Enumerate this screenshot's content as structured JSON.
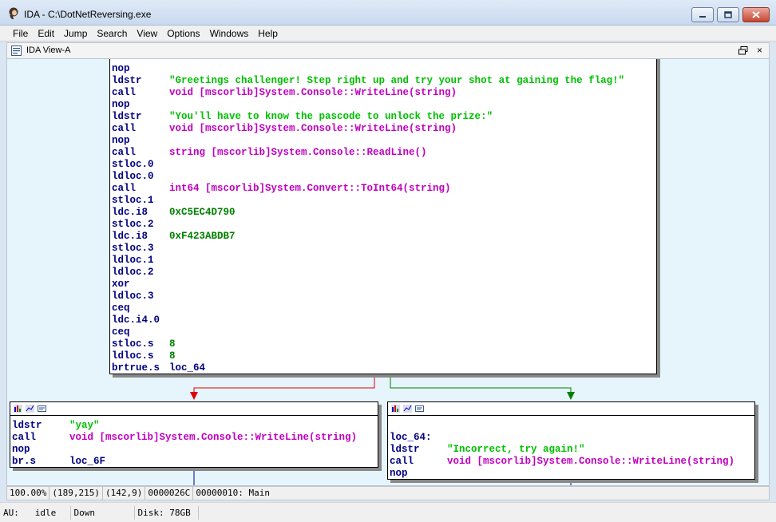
{
  "window": {
    "title": "IDA - C:\\DotNetReversing.exe"
  },
  "menu": [
    "File",
    "Edit",
    "Jump",
    "Search",
    "View",
    "Options",
    "Windows",
    "Help"
  ],
  "view": {
    "title": "IDA View-A",
    "close_glyph": "×"
  },
  "nodes": {
    "main": [
      {
        "op": "nop",
        "arg": "",
        "kind": ""
      },
      {
        "op": "ldstr",
        "arg": "\"Greetings challenger! Step right up and try your shot at gaining the flag!\"",
        "kind": "str"
      },
      {
        "op": "call",
        "arg": "void [mscorlib]System.Console::WriteLine(string)",
        "kind": "callref"
      },
      {
        "op": "nop",
        "arg": "",
        "kind": ""
      },
      {
        "op": "ldstr",
        "arg": "\"You'll have to know the pascode to unlock the prize:\"",
        "kind": "str"
      },
      {
        "op": "call",
        "arg": "void [mscorlib]System.Console::WriteLine(string)",
        "kind": "callref"
      },
      {
        "op": "nop",
        "arg": "",
        "kind": ""
      },
      {
        "op": "call",
        "arg": "string [mscorlib]System.Console::ReadLine()",
        "kind": "callref"
      },
      {
        "op": "stloc.0",
        "arg": "",
        "kind": ""
      },
      {
        "op": "ldloc.0",
        "arg": "",
        "kind": ""
      },
      {
        "op": "call",
        "arg": "int64 [mscorlib]System.Convert::ToInt64(string)",
        "kind": "callref"
      },
      {
        "op": "stloc.1",
        "arg": "",
        "kind": ""
      },
      {
        "op": "ldc.i8",
        "arg": "0xC5EC4D790",
        "kind": "num"
      },
      {
        "op": "stloc.2",
        "arg": "",
        "kind": ""
      },
      {
        "op": "ldc.i8",
        "arg": "0xF423ABDB7",
        "kind": "num"
      },
      {
        "op": "stloc.3",
        "arg": "",
        "kind": ""
      },
      {
        "op": "ldloc.1",
        "arg": "",
        "kind": ""
      },
      {
        "op": "ldloc.2",
        "arg": "",
        "kind": ""
      },
      {
        "op": "xor",
        "arg": "",
        "kind": ""
      },
      {
        "op": "ldloc.3",
        "arg": "",
        "kind": ""
      },
      {
        "op": "ceq",
        "arg": "",
        "kind": ""
      },
      {
        "op": "ldc.i4.0",
        "arg": "",
        "kind": ""
      },
      {
        "op": "ceq",
        "arg": "",
        "kind": ""
      },
      {
        "op": "stloc.s",
        "arg": "8",
        "kind": "num"
      },
      {
        "op": "ldloc.s",
        "arg": "8",
        "kind": "num"
      },
      {
        "op": "brtrue.s",
        "arg": "loc_64",
        "kind": "label"
      }
    ],
    "yay": [
      {
        "op": "ldstr",
        "arg": "\"yay\"",
        "kind": "str"
      },
      {
        "op": "call",
        "arg": "void [mscorlib]System.Console::WriteLine(string)",
        "kind": "callref"
      },
      {
        "op": "nop",
        "arg": "",
        "kind": ""
      },
      {
        "op": "br.s",
        "arg": "loc_6F",
        "kind": "label"
      }
    ],
    "loc64": [
      {
        "op": "",
        "arg": "",
        "kind": ""
      },
      {
        "op": "loc_64:",
        "arg": "",
        "kind": ""
      },
      {
        "op": "ldstr",
        "arg": "\"Incorrect, try again!\"",
        "kind": "str"
      },
      {
        "op": "call",
        "arg": "void [mscorlib]System.Console::WriteLine(string)",
        "kind": "callref"
      },
      {
        "op": "nop",
        "arg": "",
        "kind": ""
      }
    ]
  },
  "coord_bar": [
    "100.00%",
    "(189,215)",
    "(142,9)",
    "0000026C",
    "00000010: Main"
  ],
  "status_bar": {
    "au_label": "AU:",
    "au_state": "idle",
    "direction": "Down",
    "disk": "Disk: 78GB"
  },
  "colors": {
    "edge_false": "#e00000",
    "edge_true": "#008000",
    "edge_plain": "#0000a0",
    "mnemonic": "#000080",
    "string": "#00c000",
    "call": "#c000c0",
    "number": "#008000"
  },
  "icons": [
    "ida-logo-icon",
    "minimize-icon",
    "maximize-icon",
    "close-icon",
    "ida-view-icon",
    "restore-icon",
    "close-view-icon",
    "graph-color-icon",
    "graph-set-icon",
    "graph-text-icon"
  ]
}
